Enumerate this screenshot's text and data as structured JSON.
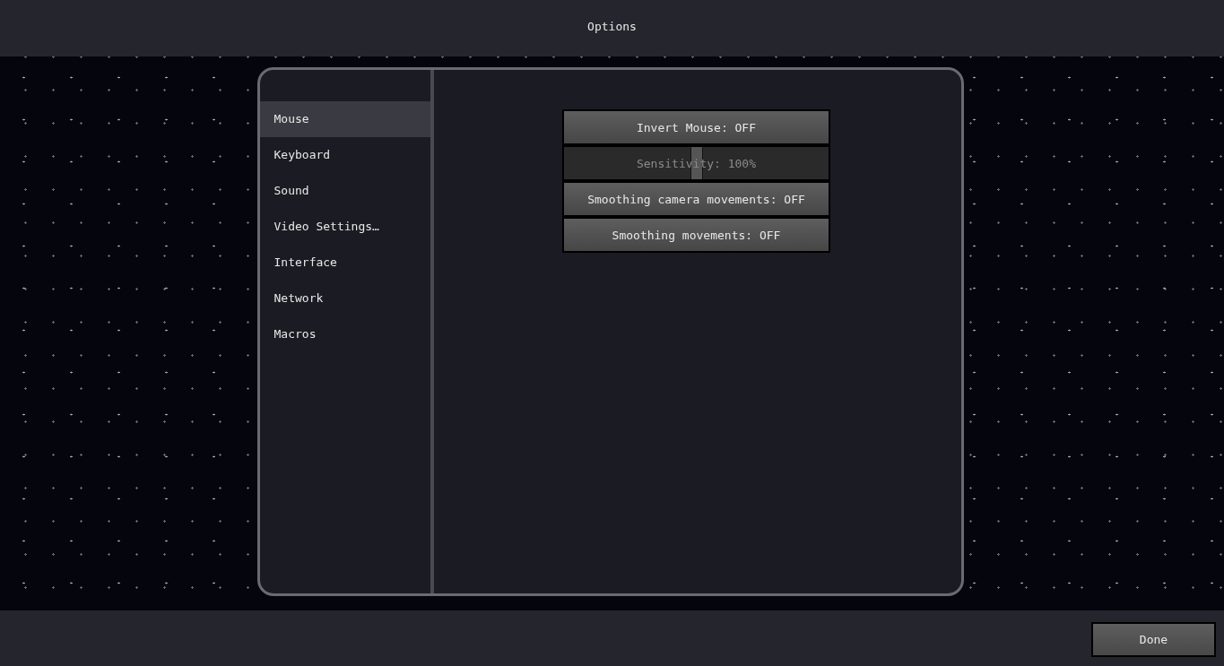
{
  "header": {
    "title": "Options"
  },
  "sidebar": {
    "items": [
      {
        "label": "Mouse",
        "selected": true
      },
      {
        "label": "Keyboard",
        "selected": false
      },
      {
        "label": "Sound",
        "selected": false
      },
      {
        "label": "Video Settings…",
        "selected": false
      },
      {
        "label": "Interface",
        "selected": false
      },
      {
        "label": "Network",
        "selected": false
      },
      {
        "label": "Macros",
        "selected": false
      }
    ]
  },
  "controls": [
    {
      "kind": "button",
      "label": "Invert Mouse: OFF"
    },
    {
      "kind": "slider",
      "label": "Sensitivity: 100%",
      "level": 0.5
    },
    {
      "kind": "button",
      "label": "Smoothing camera movements: OFF"
    },
    {
      "kind": "button",
      "label": "Smoothing movements: OFF"
    }
  ],
  "footer": {
    "done": "Done"
  }
}
